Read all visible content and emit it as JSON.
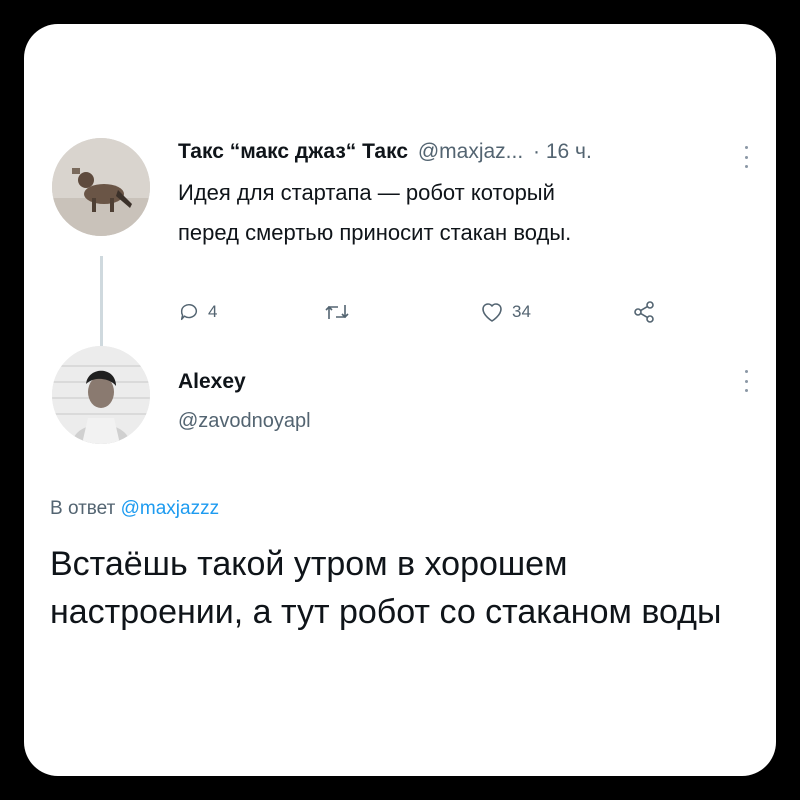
{
  "tweet": {
    "author_name": "Такс “макс джаз“ Такс",
    "author_handle": "@maxjaz...",
    "time": "· 16 ч.",
    "text_line1": "Идея для стартапа — робот который",
    "text_line2": "перед смертью приносит стакан воды.",
    "replies_count": "4",
    "likes_count": "34"
  },
  "reply": {
    "author_name": "Alexey",
    "author_handle": "@zavodnoyapl",
    "reply_to_prefix": "В ответ",
    "reply_to_handle": "@maxjazzz",
    "text": "Встаёшь такой утром в хорошем настроении, а тут робот со стаканом воды"
  },
  "colors": {
    "text": "#0f1419",
    "muted": "#536471",
    "link": "#1d9bf0",
    "thread_line": "#cfd9de"
  }
}
